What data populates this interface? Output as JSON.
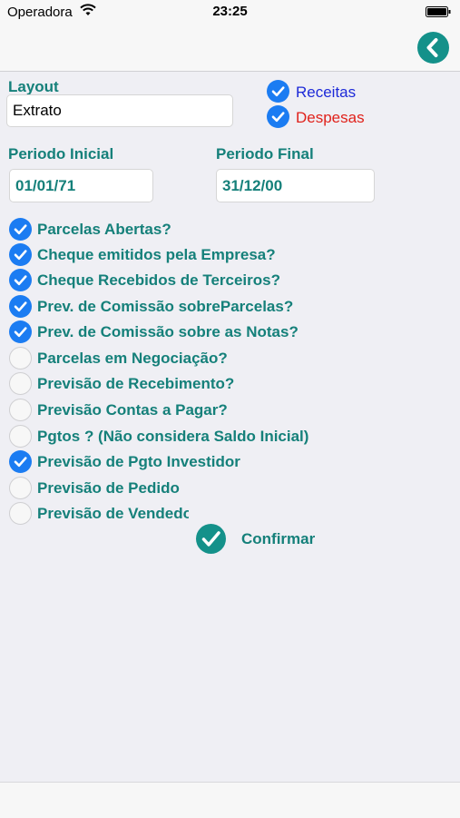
{
  "status": {
    "carrier": "Operadora",
    "time": "23:25"
  },
  "nav": {
    "back_icon": "chevron-left-icon"
  },
  "layout": {
    "label": "Layout",
    "value": "Extrato"
  },
  "types": [
    {
      "label": "Receitas",
      "checked": true,
      "color": "#1d2ad8"
    },
    {
      "label": "Despesas",
      "checked": true,
      "color": "#e0221b"
    }
  ],
  "period": {
    "start_label": "Periodo Inicial",
    "start_value": "01/01/71",
    "end_label": "Periodo Final",
    "end_value": "31/12/00"
  },
  "options": [
    {
      "label": "Parcelas Abertas?",
      "checked": true
    },
    {
      "label": "Cheque emitidos pela Empresa?",
      "checked": true
    },
    {
      "label": "Cheque Recebidos de Terceiros?",
      "checked": true
    },
    {
      "label": "Prev. de Comissão sobreParcelas?",
      "checked": true
    },
    {
      "label": "Prev. de Comissão  sobre as Notas?",
      "checked": true
    },
    {
      "label": "Parcelas em Negociação?",
      "checked": false
    },
    {
      "label": "Previsão de Recebimento?",
      "checked": false
    },
    {
      "label": "Previsão Contas a Pagar?",
      "checked": false
    },
    {
      "label": "Pgtos ? (Não considera Saldo Inicial)",
      "checked": false
    },
    {
      "label": "Previsão de Pgto Investidor",
      "checked": true
    },
    {
      "label": "Previsão de Pedido",
      "checked": false
    },
    {
      "label": "Previsão de Vendedor",
      "checked": false
    }
  ],
  "confirm": {
    "label": "Confirmar"
  },
  "colors": {
    "accent": "#14918a",
    "check_blue": "#1b7cf2",
    "label_teal": "#15807a"
  }
}
